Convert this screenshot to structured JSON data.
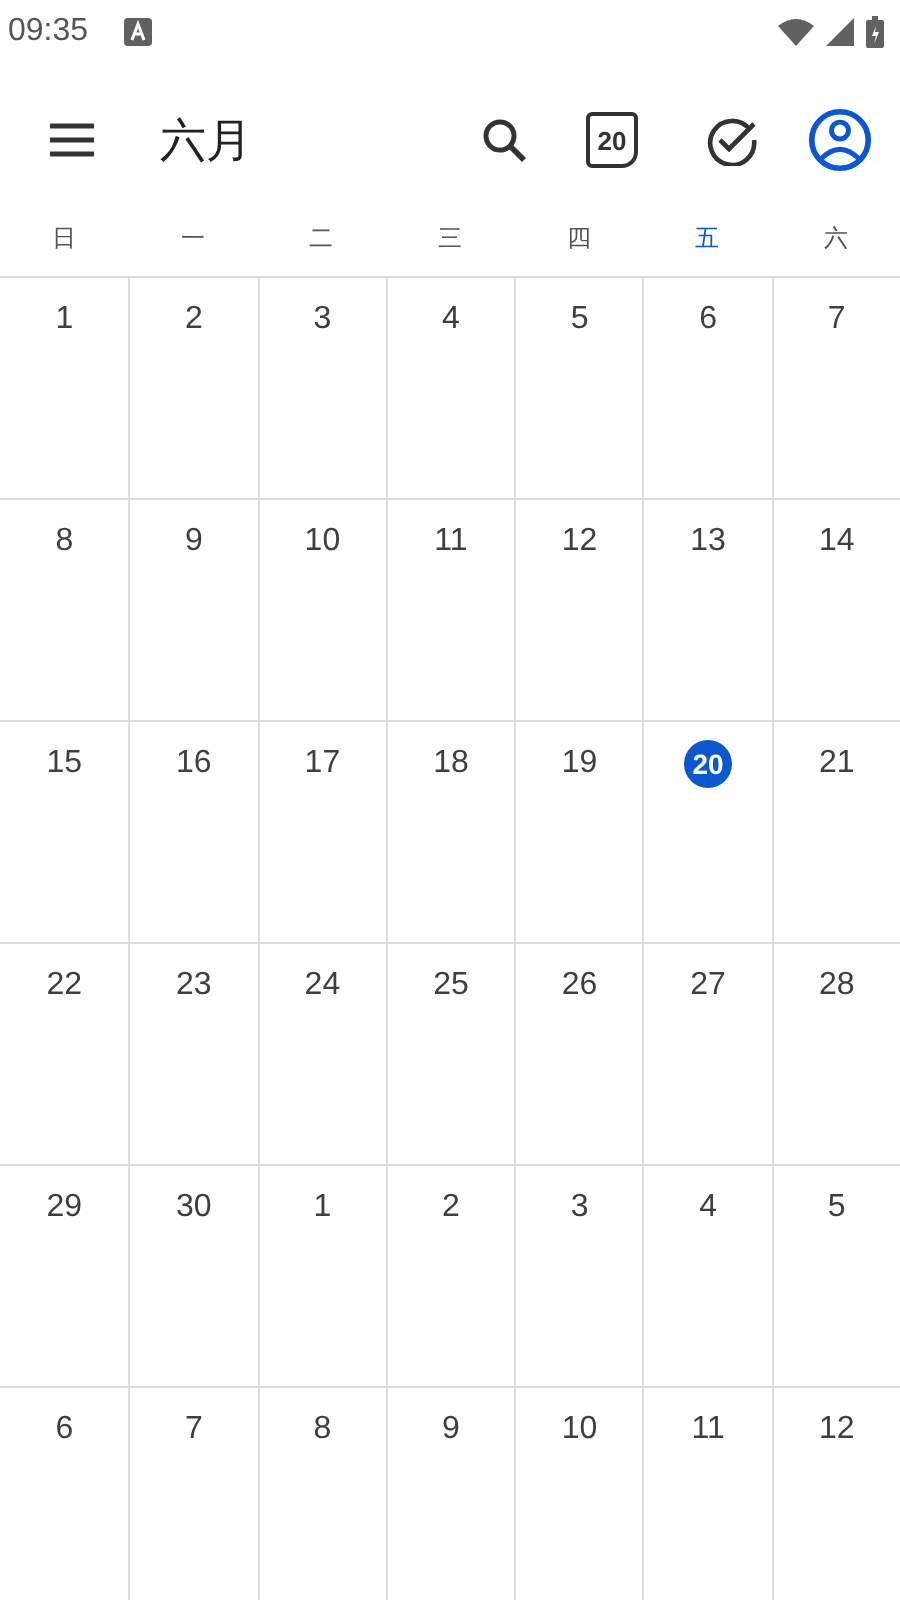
{
  "status_bar": {
    "time": "09:35"
  },
  "app_bar": {
    "title": "六月",
    "today_badge": "20"
  },
  "weekdays": [
    {
      "label": "日",
      "selected": false
    },
    {
      "label": "一",
      "selected": false
    },
    {
      "label": "二",
      "selected": false
    },
    {
      "label": "三",
      "selected": false
    },
    {
      "label": "四",
      "selected": false
    },
    {
      "label": "五",
      "selected": true
    },
    {
      "label": "六",
      "selected": false
    }
  ],
  "weeks": [
    [
      {
        "date": "1",
        "today": false
      },
      {
        "date": "2",
        "today": false
      },
      {
        "date": "3",
        "today": false
      },
      {
        "date": "4",
        "today": false
      },
      {
        "date": "5",
        "today": false
      },
      {
        "date": "6",
        "today": false
      },
      {
        "date": "7",
        "today": false
      }
    ],
    [
      {
        "date": "8",
        "today": false
      },
      {
        "date": "9",
        "today": false
      },
      {
        "date": "10",
        "today": false
      },
      {
        "date": "11",
        "today": false
      },
      {
        "date": "12",
        "today": false
      },
      {
        "date": "13",
        "today": false
      },
      {
        "date": "14",
        "today": false
      }
    ],
    [
      {
        "date": "15",
        "today": false
      },
      {
        "date": "16",
        "today": false
      },
      {
        "date": "17",
        "today": false
      },
      {
        "date": "18",
        "today": false
      },
      {
        "date": "19",
        "today": false
      },
      {
        "date": "20",
        "today": true
      },
      {
        "date": "21",
        "today": false
      }
    ],
    [
      {
        "date": "22",
        "today": false
      },
      {
        "date": "23",
        "today": false
      },
      {
        "date": "24",
        "today": false
      },
      {
        "date": "25",
        "today": false
      },
      {
        "date": "26",
        "today": false
      },
      {
        "date": "27",
        "today": false
      },
      {
        "date": "28",
        "today": false
      }
    ],
    [
      {
        "date": "29",
        "today": false
      },
      {
        "date": "30",
        "today": false
      },
      {
        "date": "1",
        "today": false
      },
      {
        "date": "2",
        "today": false
      },
      {
        "date": "3",
        "today": false
      },
      {
        "date": "4",
        "today": false
      },
      {
        "date": "5",
        "today": false
      }
    ],
    [
      {
        "date": "6",
        "today": false
      },
      {
        "date": "7",
        "today": false
      },
      {
        "date": "8",
        "today": false
      },
      {
        "date": "9",
        "today": false
      },
      {
        "date": "10",
        "today": false
      },
      {
        "date": "11",
        "today": false
      },
      {
        "date": "12",
        "today": false
      }
    ]
  ]
}
